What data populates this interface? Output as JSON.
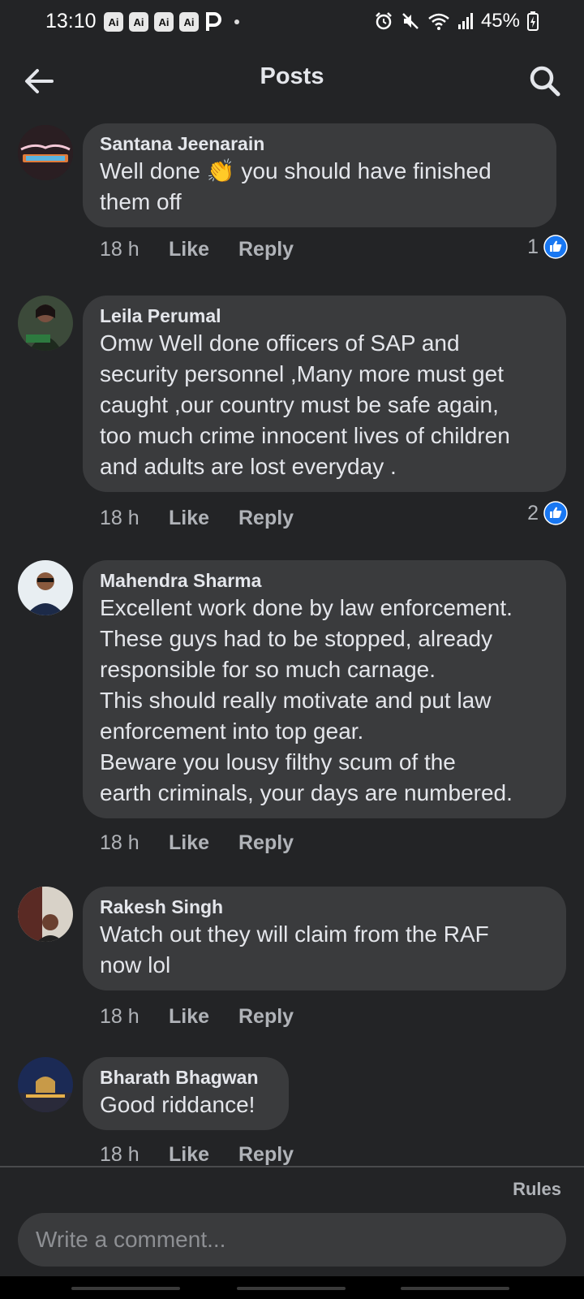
{
  "status_bar": {
    "time": "13:10",
    "app_icons": [
      "Ai",
      "Ai",
      "Ai",
      "Ai"
    ],
    "battery": "45%"
  },
  "header": {
    "title": "Posts"
  },
  "comments": [
    {
      "author": "Santana Jeenarain",
      "lines": [
        "Well done 👏  you should have finished",
        "them off"
      ],
      "time": "18 h",
      "like_label": "Like",
      "reply_label": "Reply",
      "reactions": "1"
    },
    {
      "author": "Leila Perumal",
      "lines": [
        "Omw Well done officers of SAP and",
        "security personnel ,Many more must get",
        "caught ,our country must be safe again,",
        "too much crime innocent lives of children",
        "and adults are lost everyday ."
      ],
      "time": "18 h",
      "like_label": "Like",
      "reply_label": "Reply",
      "reactions": "2"
    },
    {
      "author": "Mahendra Sharma",
      "lines": [
        "Excellent work done by law enforcement.",
        "These guys had to be stopped, already",
        "responsible for so much carnage.",
        "This should really motivate and put law",
        "enforcement into top gear.",
        "Beware you lousy filthy scum of the",
        "earth criminals, your days are numbered."
      ],
      "time": "18 h",
      "like_label": "Like",
      "reply_label": "Reply"
    },
    {
      "author": "Rakesh Singh",
      "lines": [
        "Watch out they  will claim from the RAF",
        "now lol"
      ],
      "time": "18 h",
      "like_label": "Like",
      "reply_label": "Reply"
    },
    {
      "author": "Bharath Bhagwan",
      "lines": [
        "Good riddance!"
      ],
      "time": "18 h",
      "like_label": "Like",
      "reply_label": "Reply"
    }
  ],
  "footer": {
    "rules_label": "Rules",
    "comment_placeholder": "Write a comment..."
  },
  "colors": {
    "background": "#232426",
    "bubble": "#3a3b3d",
    "like_blue": "#1877f2",
    "secondary_text": "#b0b3b8"
  }
}
